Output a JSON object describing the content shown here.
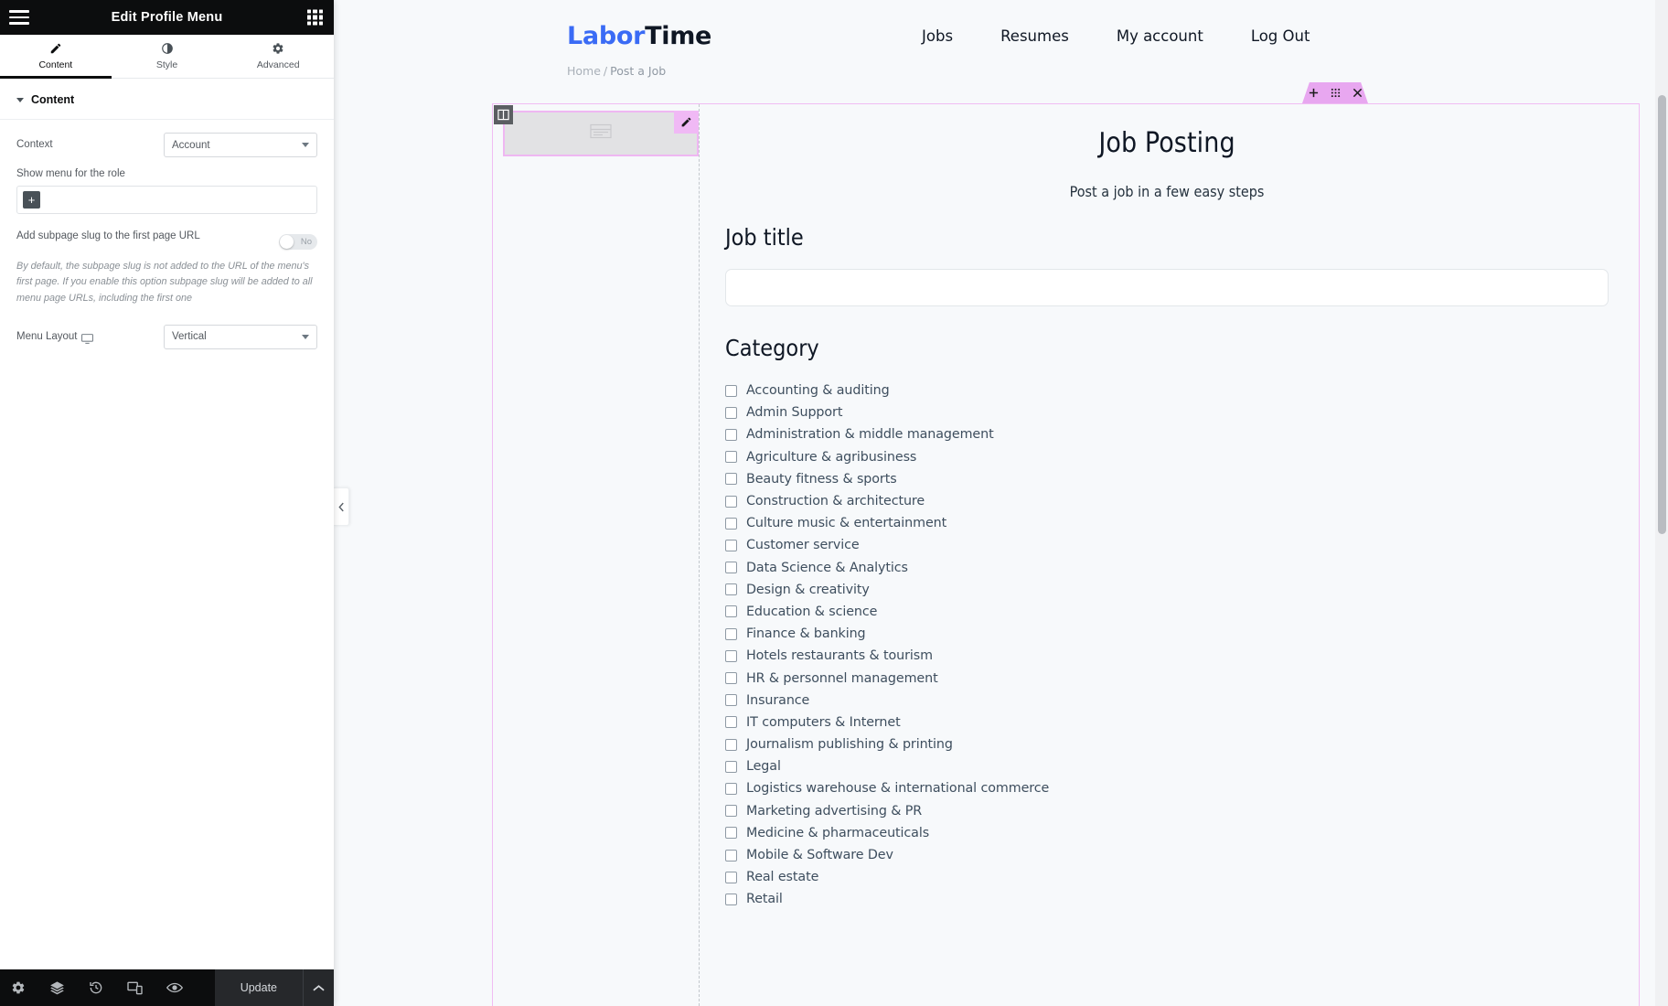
{
  "panel": {
    "title": "Edit Profile Menu",
    "menu_icon": "hamburger-icon",
    "apps_icon": "apps-grid-icon",
    "tabs": [
      {
        "label": "Content",
        "icon": "pencil-icon",
        "active": true
      },
      {
        "label": "Style",
        "icon": "contrast-icon",
        "active": false
      },
      {
        "label": "Advanced",
        "icon": "gear-icon",
        "active": false
      }
    ],
    "section": {
      "title": "Content",
      "collapsed": false
    },
    "controls": {
      "context_label": "Context",
      "context_value": "Account",
      "role_label": "Show menu for the role",
      "role_add_button": "+",
      "subpage_label": "Add subpage slug to the first page URL",
      "subpage_toggle_value": "No",
      "subpage_help": "By default, the subpage slug is not added to the URL of the menu's first page. If you enable this option subpage slug will be added to all menu page URLs, including the first one",
      "menu_layout_label": "Menu Layout",
      "menu_layout_device_icon": "desktop-icon",
      "menu_layout_value": "Vertical"
    },
    "footer": {
      "tools": [
        {
          "name": "settings-icon"
        },
        {
          "name": "navigator-layers-icon"
        },
        {
          "name": "history-icon"
        },
        {
          "name": "responsive-mode-icon"
        },
        {
          "name": "preview-eye-icon"
        }
      ],
      "update_label": "Update",
      "caret_icon": "chevron-up-icon"
    },
    "collapse_handle_icon": "chevron-left-icon"
  },
  "preview": {
    "logo": {
      "part1": "Labor",
      "part2": "Time"
    },
    "nav": [
      {
        "label": "Jobs"
      },
      {
        "label": "Resumes"
      },
      {
        "label": "My account"
      },
      {
        "label": "Log Out"
      }
    ],
    "breadcrumb": {
      "home": "Home",
      "separator": "/",
      "current": "Post a Job"
    },
    "section_toolbar": {
      "add_icon": "plus-icon",
      "drag_icon": "drag-dots-icon",
      "close_icon": "close-x-icon"
    },
    "column_handle_icon": "column-icon",
    "widget": {
      "placeholder_icon": "nav-menu-widget-icon",
      "edit_icon": "pencil-edit-icon"
    },
    "content": {
      "title": "Job Posting",
      "subtitle": "Post a job in a few easy steps",
      "job_title_label": "Job title",
      "job_title_value": "",
      "job_title_placeholder": "",
      "category_label": "Category",
      "categories": [
        "Accounting & auditing",
        "Admin Support",
        "Administration & middle management",
        "Agriculture & agribusiness",
        "Beauty fitness & sports",
        "Construction & architecture",
        "Culture music & entertainment",
        "Customer service",
        "Data Science & Analytics",
        "Design & creativity",
        "Education & science",
        "Finance & banking",
        "Hotels restaurants & tourism",
        "HR & personnel management",
        "Insurance",
        "IT computers & Internet",
        "Journalism publishing & printing",
        "Legal",
        "Logistics warehouse & international commerce",
        "Marketing advertising & PR",
        "Medicine & pharmaceuticals",
        "Mobile & Software Dev",
        "Real estate",
        "Retail"
      ]
    }
  },
  "colors": {
    "panel_dark": "#0c0d0e",
    "brand_blue": "#3a6bf5",
    "elementor_pink": "#e8a7f0",
    "text_slate": "#3e4e5e"
  }
}
